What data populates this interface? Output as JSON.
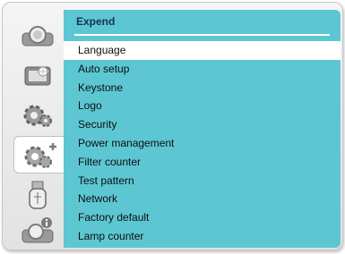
{
  "window": {
    "title": "Expend"
  },
  "sidebar": {
    "icons": [
      {
        "name": "screen-icon",
        "selected": false
      },
      {
        "name": "display-adjust-icon",
        "selected": false
      },
      {
        "name": "settings-gears-icon",
        "selected": false
      },
      {
        "name": "expand-gears-icon",
        "selected": true
      },
      {
        "name": "usb-icon",
        "selected": false
      },
      {
        "name": "info-icon",
        "selected": false
      }
    ]
  },
  "menu": {
    "items": [
      {
        "label": "Language",
        "selected": true
      },
      {
        "label": "Auto setup",
        "selected": false
      },
      {
        "label": "Keystone",
        "selected": false
      },
      {
        "label": "Logo",
        "selected": false
      },
      {
        "label": "Security",
        "selected": false
      },
      {
        "label": "Power management",
        "selected": false
      },
      {
        "label": "Filter counter",
        "selected": false
      },
      {
        "label": "Test pattern",
        "selected": false
      },
      {
        "label": "Network",
        "selected": false
      },
      {
        "label": "Factory default",
        "selected": false
      },
      {
        "label": "Lamp counter",
        "selected": false
      }
    ]
  },
  "colors": {
    "panel": "#5cc7d3",
    "selected_bg": "#ffffff",
    "title": "#15354a"
  }
}
